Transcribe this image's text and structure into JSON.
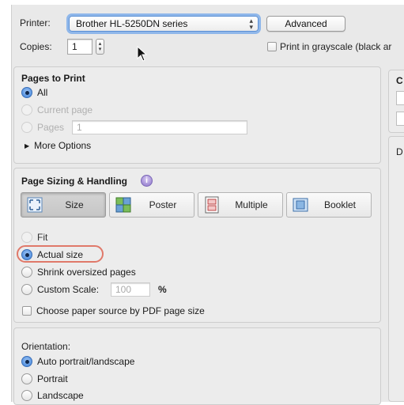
{
  "printer": {
    "label": "Printer:",
    "value": "Brother HL-5250DN series",
    "advanced_label": "Advanced"
  },
  "copies": {
    "label": "Copies:",
    "value": "1",
    "grayscale_label": "Print in grayscale (black ar"
  },
  "pages": {
    "title": "Pages to Print",
    "all_label": "All",
    "current_label": "Current page",
    "pages_label": "Pages",
    "pages_value": "1",
    "more_label": "More Options"
  },
  "sizing": {
    "title": "Page Sizing & Handling",
    "tabs": [
      {
        "label": "Size",
        "icon": "size-icon"
      },
      {
        "label": "Poster",
        "icon": "poster-icon"
      },
      {
        "label": "Multiple",
        "icon": "multiple-icon"
      },
      {
        "label": "Booklet",
        "icon": "booklet-icon"
      }
    ],
    "fit_label": "Fit",
    "actual_label": "Actual size",
    "shrink_label": "Shrink oversized pages",
    "custom_label": "Custom Scale:",
    "custom_value": "100",
    "percent": "%",
    "paper_source_label": "Choose paper source by PDF page size"
  },
  "orientation": {
    "title": "Orientation:",
    "auto_label": "Auto portrait/landscape",
    "portrait_label": "Portrait",
    "landscape_label": "Landscape"
  },
  "right_panel": {
    "c_label": "C",
    "d_label": "D"
  },
  "colors": {
    "accent": "#3a7fd8",
    "highlight": "#e0796a"
  }
}
